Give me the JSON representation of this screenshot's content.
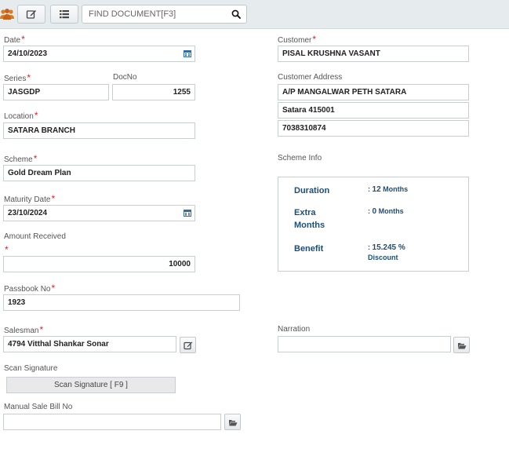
{
  "toolbar": {
    "search_placeholder": "FIND DOCUMENT[F3]",
    "icons": [
      "users-icon",
      "edit-icon",
      "list-icon",
      "search-icon"
    ]
  },
  "form": {
    "date": {
      "label": "Date",
      "value": "24/10/2023"
    },
    "series": {
      "label": "Series",
      "value": "JASGDP"
    },
    "docno": {
      "label": "DocNo",
      "value": "1255"
    },
    "location": {
      "label": "Location",
      "value": "SATARA BRANCH"
    },
    "scheme": {
      "label": "Scheme",
      "value": "Gold Dream Plan"
    },
    "maturity_date": {
      "label": "Maturity Date",
      "value": "23/10/2024"
    },
    "amount_received": {
      "label": "Amount Received",
      "value": "10000"
    },
    "passbook_no": {
      "label": "Passbook No",
      "value": "1923"
    },
    "salesman": {
      "label": "Salesman",
      "value": "4794 Vitthal Shankar Sonar"
    },
    "scan_signature": {
      "label": "Scan Signature",
      "button": "Scan Signature [ F9 ]"
    },
    "manual_sale_bill_no": {
      "label": "Manual Sale Bill No",
      "value": ""
    },
    "customer": {
      "label": "Customer",
      "value": "PISAL KRUSHNA VASANT"
    },
    "customer_address": {
      "label": "Customer Address",
      "line1": "A/P MANGALWAR PETH SATARA",
      "line2": "Satara 415001",
      "line3": "7038310874"
    },
    "scheme_info": {
      "label": "Scheme Info",
      "duration_label": "Duration",
      "duration_value": "12",
      "duration_unit": "Months",
      "extra_label_1": "Extra",
      "extra_label_2": "Months",
      "extra_value": "0",
      "extra_unit": "Months",
      "benefit_label": "Benefit",
      "benefit_value": "15.245 %",
      "benefit_unit": "Discount"
    },
    "narration": {
      "label": "Narration",
      "value": ""
    },
    "required_mark": "*",
    "colon": ":"
  },
  "colors": {
    "required": "#d9232e",
    "info_text": "#1f4e75",
    "toolbar_bg": "#e6ebee",
    "users_icon": "#e07b1c"
  }
}
